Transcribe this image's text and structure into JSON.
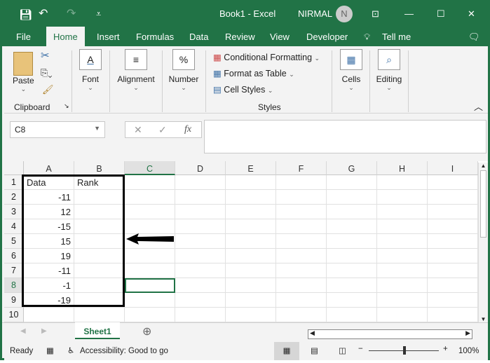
{
  "title": {
    "doc": "Book1  -  Excel",
    "user": "NIRMAL",
    "avatar": "N"
  },
  "tabs": [
    "File",
    "Home",
    "Insert",
    "Formulas",
    "Data",
    "Review",
    "View",
    "Developer",
    "Tell me"
  ],
  "ribbon": {
    "paste": "Paste",
    "clipboard": "Clipboard",
    "font": "Font",
    "alignment": "Alignment",
    "number": "Number",
    "number_icon": "%",
    "cond": "Conditional Formatting",
    "fmt_table": "Format as Table",
    "cell_styles": "Cell Styles",
    "styles": "Styles",
    "cells": "Cells",
    "editing": "Editing"
  },
  "formula": {
    "namebox": "C8",
    "fx": "fx",
    "value": ""
  },
  "columns": [
    "A",
    "B",
    "C",
    "D",
    "E",
    "F",
    "G",
    "H",
    "I"
  ],
  "rows": [
    [
      "Data",
      "Rank"
    ],
    [
      "-11",
      ""
    ],
    [
      "12",
      ""
    ],
    [
      "-15",
      ""
    ],
    [
      "15",
      ""
    ],
    [
      "19",
      ""
    ],
    [
      "-11",
      ""
    ],
    [
      "-1",
      ""
    ],
    [
      "-19",
      ""
    ],
    [
      "",
      ""
    ]
  ],
  "selected_cell": "C8",
  "sheet_tab": "Sheet1",
  "status": {
    "ready": "Ready",
    "accessibility": "Accessibility: Good to go",
    "zoom": "100%"
  },
  "colors": {
    "accent": "#217346"
  }
}
